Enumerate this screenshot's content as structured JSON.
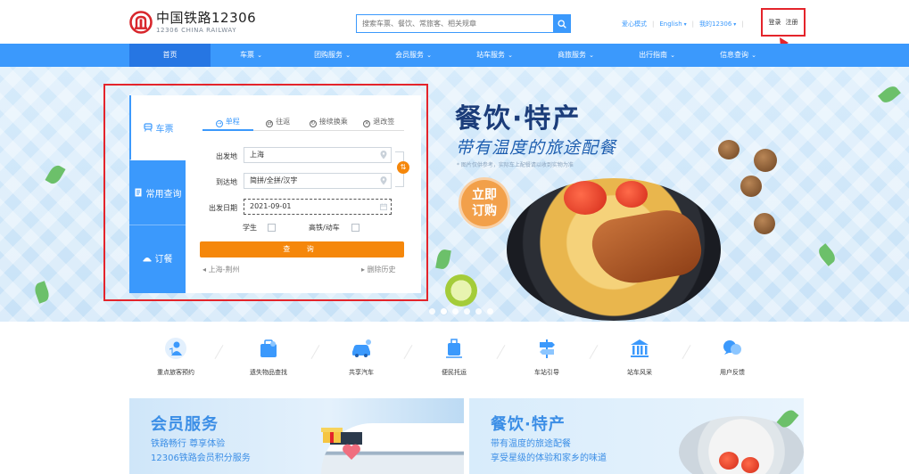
{
  "header": {
    "logo_cn": "中国铁路12306",
    "logo_en": "12306 CHINA RAILWAY",
    "search_placeholder": "搜索车票、餐饮、常旅客、相关规章",
    "links": {
      "care_mode": "爱心模式",
      "language": "English",
      "my_12306": "我的12306"
    },
    "login": "登录",
    "register": "注册",
    "colors": {
      "brand": "#3b99fc",
      "highlight": "#e4242b"
    }
  },
  "nav": {
    "items": [
      {
        "label": "首页",
        "dropdown": false,
        "active": true
      },
      {
        "label": "车票",
        "dropdown": true
      },
      {
        "label": "团购服务",
        "dropdown": true
      },
      {
        "label": "会员服务",
        "dropdown": true
      },
      {
        "label": "站车服务",
        "dropdown": true
      },
      {
        "label": "商旅服务",
        "dropdown": true
      },
      {
        "label": "出行指南",
        "dropdown": true
      },
      {
        "label": "信息查询",
        "dropdown": true
      }
    ]
  },
  "booking": {
    "side_tabs": [
      {
        "label": "车票",
        "icon": "train-icon",
        "active": true
      },
      {
        "label": "常用查询",
        "icon": "document-icon"
      },
      {
        "label": "订餐",
        "icon": "dining-icon"
      }
    ],
    "trip_types": [
      {
        "label": "单程",
        "active": true
      },
      {
        "label": "往返"
      },
      {
        "label": "接续换乘"
      },
      {
        "label": "退改签"
      }
    ],
    "from_label": "出发地",
    "from_value": "上海",
    "to_label": "到达地",
    "to_placeholder": "简拼/全拼/汉字",
    "date_label": "出发日期",
    "date_value": "2021-09-01",
    "student_label": "学生",
    "highspeed_label": "高铁/动车",
    "search_label": "查 询",
    "history_item": "上海-荆州",
    "clear_history": "删除历史",
    "colors": {
      "action": "#f5870b"
    }
  },
  "promo": {
    "title": "餐饮·特产",
    "subtitle": "带有温度的旅途配餐",
    "note": "* 图片仅供参考，实际车上配餐请以收到实物为准",
    "buy_line1": "立即",
    "buy_line2": "订购",
    "slides": 6,
    "active_slide": 1
  },
  "services": [
    {
      "label": "重点旅客预约",
      "icon": "passenger-icon"
    },
    {
      "label": "遗失物品查找",
      "icon": "lost-item-icon"
    },
    {
      "label": "共享汽车",
      "icon": "car-icon"
    },
    {
      "label": "便民托运",
      "icon": "luggage-icon"
    },
    {
      "label": "车站引导",
      "icon": "signpost-icon"
    },
    {
      "label": "站车风采",
      "icon": "station-icon"
    },
    {
      "label": "用户反馈",
      "icon": "feedback-icon"
    }
  ],
  "cards": {
    "member": {
      "title": "会员服务",
      "line1": "铁路畅行 尊享体验",
      "line2": "12306铁路会员积分服务"
    },
    "dining": {
      "title": "餐饮·特产",
      "line1": "带有温度的旅途配餐",
      "line2": "享受星级的体验和家乡的味道"
    }
  }
}
